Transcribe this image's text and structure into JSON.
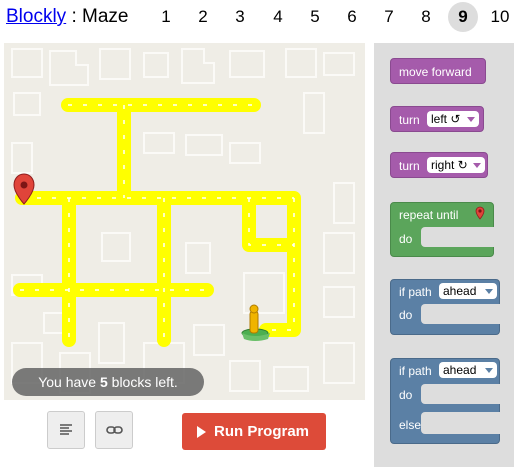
{
  "header": {
    "app_link": "Blockly",
    "separator": ":",
    "title": "Maze",
    "levels": [
      "1",
      "2",
      "3",
      "4",
      "5",
      "6",
      "7",
      "8",
      "9",
      "10"
    ],
    "current_level": "9"
  },
  "status": {
    "blocks_left_prefix": "You have ",
    "blocks_left_count": "5",
    "blocks_left_suffix": " blocks left."
  },
  "controls": {
    "code_icon": "code-icon",
    "link_icon": "link-icon",
    "run_label": "Run Program",
    "run_color": "#dd4b39"
  },
  "toolbox": {
    "move_forward": "move forward",
    "turn_left_label": "turn",
    "turn_left_value": "left ↺",
    "turn_right_label": "turn",
    "turn_right_value": "right ↻",
    "repeat_until": "repeat until",
    "repeat_do": "do",
    "if_path_label": "if path",
    "if_path_value": "ahead",
    "if_do": "do",
    "ifelse_path_label": "if path",
    "ifelse_path_value": "ahead",
    "ifelse_do": "do",
    "ifelse_else": "else"
  },
  "colors": {
    "movement": "#a55bab",
    "loop": "#5ba55b",
    "logic": "#5b80a5",
    "path": "#ffff00",
    "maze_background": "#efede6",
    "toolbox_background": "#dddddd"
  }
}
